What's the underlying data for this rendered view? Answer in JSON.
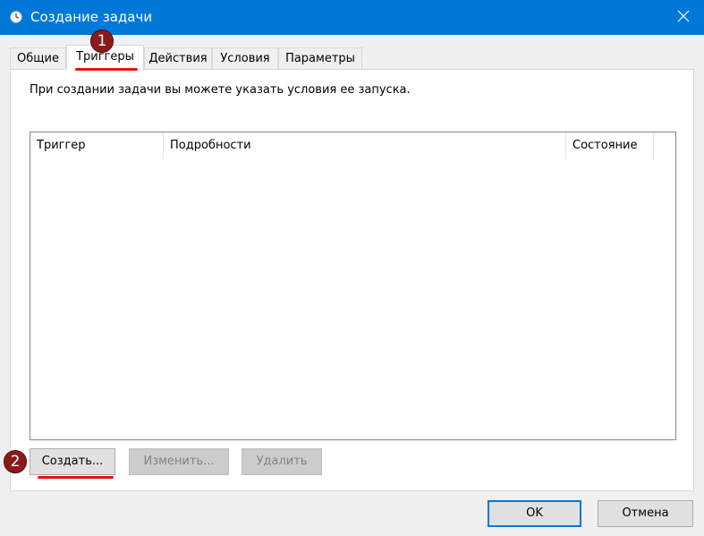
{
  "window": {
    "title": "Создание задачи",
    "title_icon": "clock-icon",
    "close_icon": "close-icon",
    "titlebar_color": "#0078d7"
  },
  "tabs": [
    {
      "label": "Общие",
      "selected": false
    },
    {
      "label": "Триггеры",
      "selected": true
    },
    {
      "label": "Действия",
      "selected": false
    },
    {
      "label": "Условия",
      "selected": false
    },
    {
      "label": "Параметры",
      "selected": false
    }
  ],
  "panel": {
    "description": "При создании задачи вы можете указать условия ее запуска."
  },
  "triggers_table": {
    "columns": [
      "Триггер",
      "Подробности",
      "Состояние"
    ],
    "rows": []
  },
  "panel_buttons": {
    "create_label": "Создать...",
    "edit_label": "Изменить...",
    "delete_label": "Удалить"
  },
  "dialog_buttons": {
    "ok_label": "OK",
    "cancel_label": "Отмена"
  },
  "annotations": {
    "badge_1": "1",
    "badge_2": "2",
    "marker_color": "#8b1a1a",
    "underline_color": "#e8130f"
  }
}
